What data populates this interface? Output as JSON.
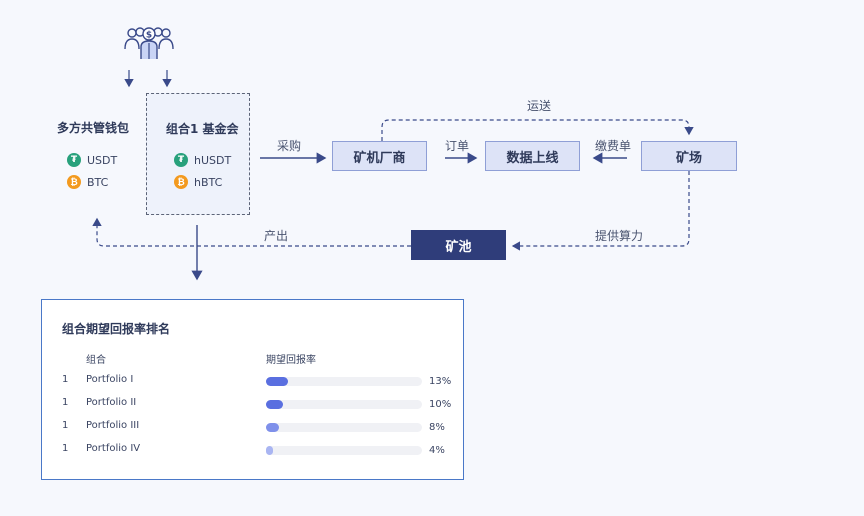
{
  "wallet": {
    "title": "多方共管钱包",
    "assets": [
      {
        "icon": "tether-icon",
        "label": "USDT"
      },
      {
        "icon": "bitcoin-icon",
        "label": "BTC"
      }
    ]
  },
  "fund": {
    "title": "组合1 基金会",
    "assets": [
      {
        "icon": "tether-icon",
        "label": "hUSDT"
      },
      {
        "icon": "bitcoin-icon",
        "label": "hBTC"
      }
    ]
  },
  "nodes": {
    "manufacturer": "矿机厂商",
    "data_chain": "数据上线",
    "farm": "矿场",
    "pool": "矿池"
  },
  "edges": {
    "purchase": "采购",
    "order": "订单",
    "fee_bill": "缴费单",
    "transport": "运送",
    "hashrate": "提供算力",
    "output": "产出"
  },
  "colors": {
    "node_fill": "#dde3f7",
    "pool_fill": "#2f3d7a",
    "arrow": "#3a4a8a",
    "bar_colors": [
      "#5a6fe0",
      "#5a6fe0",
      "#7f90ea",
      "#a9b5f2"
    ]
  },
  "ranking": {
    "title": "组合期望回报率排名",
    "col_portfolio": "组合",
    "col_return": "期望回报率",
    "rows": [
      {
        "rank": "1",
        "name": "Portfolio I",
        "pct": "13%",
        "value": 0.13
      },
      {
        "rank": "1",
        "name": "Portfolio II",
        "pct": "10%",
        "value": 0.1
      },
      {
        "rank": "1",
        "name": "Portfolio III",
        "pct": "8%",
        "value": 0.08
      },
      {
        "rank": "1",
        "name": "Portfolio IV",
        "pct": "4%",
        "value": 0.04
      }
    ]
  }
}
